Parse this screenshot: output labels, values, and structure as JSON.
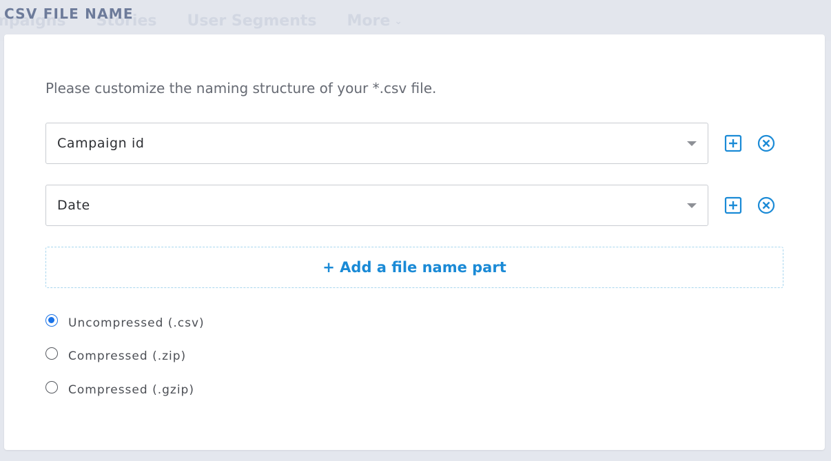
{
  "background_nav": {
    "items": [
      "mpaigns",
      "Stories",
      "User Segments",
      "More"
    ]
  },
  "section": {
    "title": "CSV FILE NAME"
  },
  "description": "Please customize the naming structure of your *.csv file.",
  "file_name_parts": [
    {
      "value": "Campaign id"
    },
    {
      "value": "Date"
    }
  ],
  "add_part_label": "+ Add a file name part",
  "compression": {
    "options": [
      {
        "label": "Uncompressed (.csv)",
        "checked": true
      },
      {
        "label": "Compressed (.zip)",
        "checked": false
      },
      {
        "label": "Compressed (.gzip)",
        "checked": false
      }
    ]
  },
  "colors": {
    "accent": "#1a8ad6",
    "radio_selected": "#1a73e8",
    "title": "#6d7b9a",
    "page_background": "#e4e7ee",
    "card_background": "#ffffff"
  },
  "icons": {
    "add": "plus-square-icon",
    "remove": "circle-x-icon",
    "dropdown": "caret-down-icon",
    "nav_more": "chevron-down-icon"
  }
}
